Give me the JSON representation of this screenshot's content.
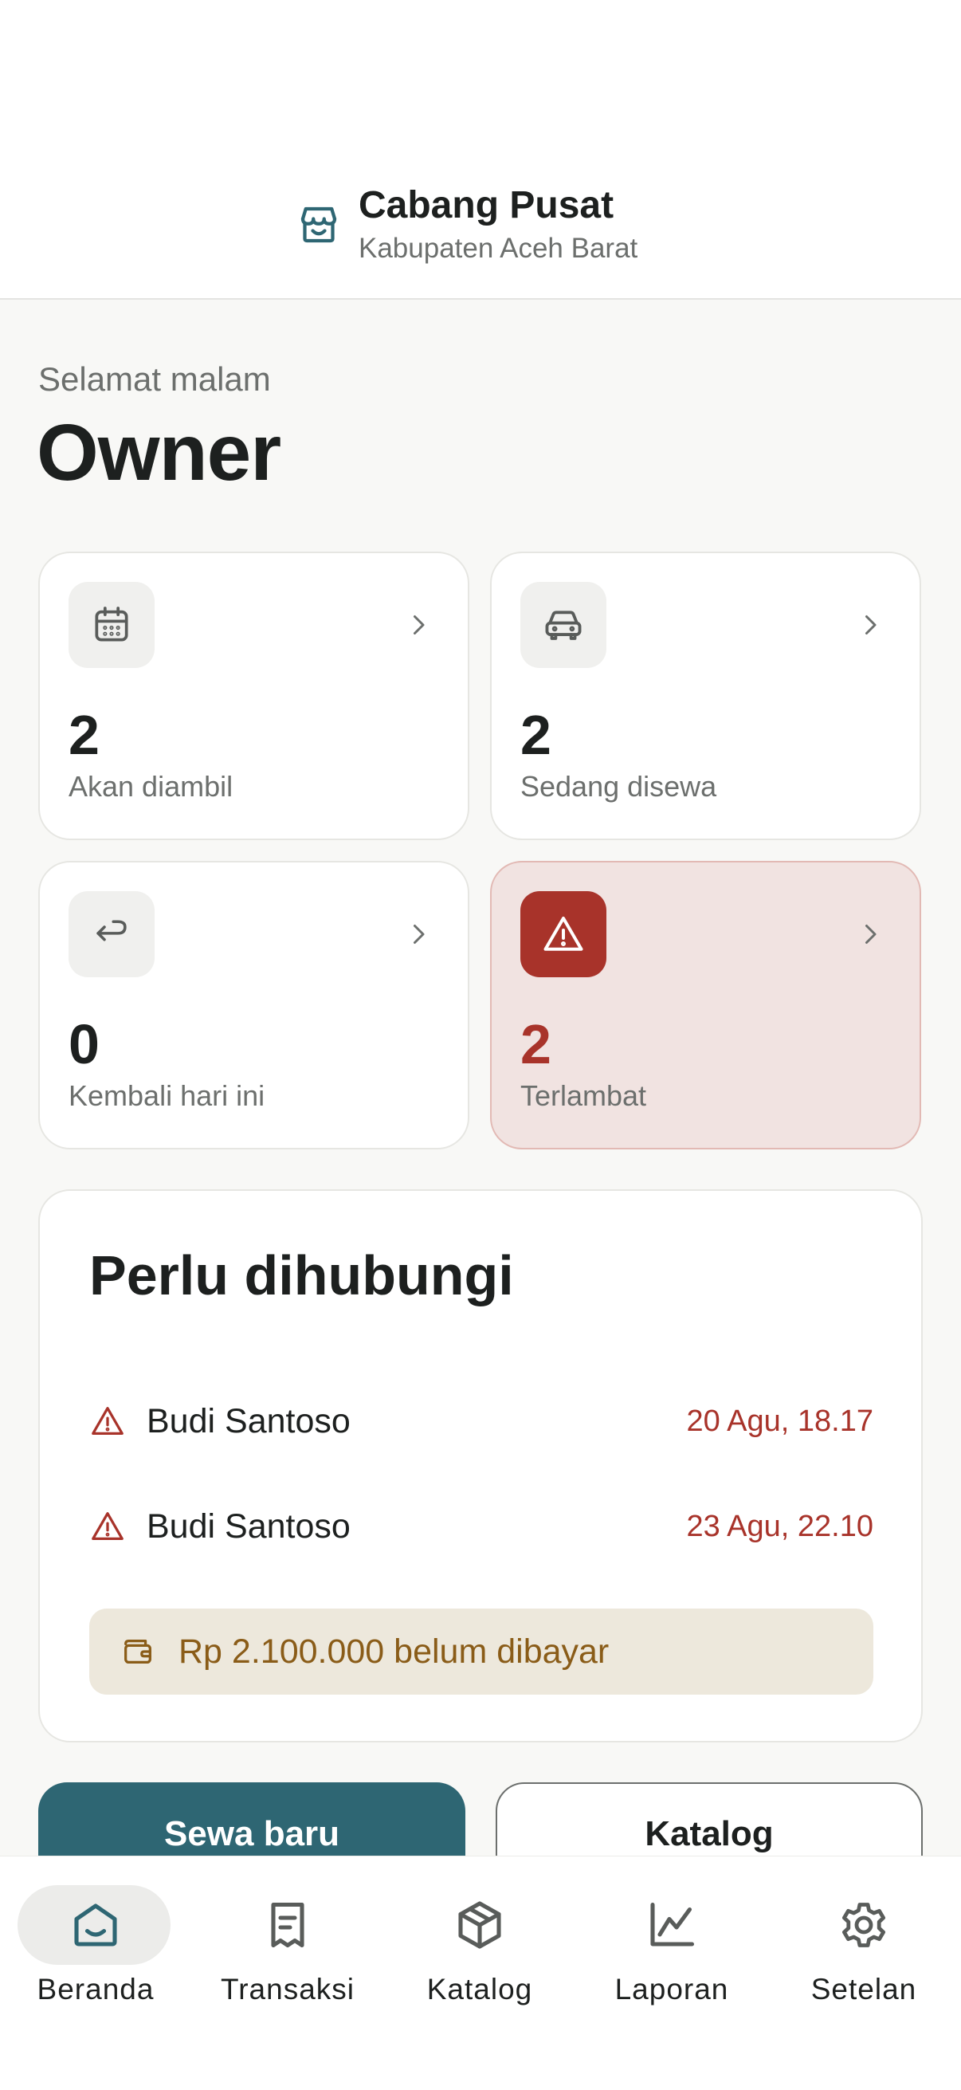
{
  "header": {
    "branch_name": "Cabang Pusat",
    "branch_location": "Kabupaten Aceh Barat",
    "icon": "store-icon"
  },
  "greeting": {
    "salutation": "Selamat malam",
    "user": "Owner"
  },
  "stats": [
    {
      "count": "2",
      "label": "Akan diambil",
      "icon": "calendar-icon"
    },
    {
      "count": "2",
      "label": "Sedang disewa",
      "icon": "car-icon"
    },
    {
      "count": "0",
      "label": "Kembali hari ini",
      "icon": "return-arrow-icon"
    },
    {
      "count": "2",
      "label": "Terlambat",
      "icon": "warning-icon",
      "status": "alert"
    }
  ],
  "contact": {
    "title": "Perlu dihubungi",
    "items": [
      {
        "name": "Budi Santoso",
        "date": "20 Agu, 18.17"
      },
      {
        "name": "Budi Santoso",
        "date": "23 Agu, 22.10"
      }
    ],
    "unpaid": "Rp 2.100.000 belum dibayar"
  },
  "actions": {
    "primary": "Sewa baru",
    "secondary": "Katalog"
  },
  "nav": [
    {
      "label": "Beranda",
      "icon": "home-icon",
      "active": true
    },
    {
      "label": "Transaksi",
      "icon": "receipt-icon"
    },
    {
      "label": "Katalog",
      "icon": "box-icon"
    },
    {
      "label": "Laporan",
      "icon": "chart-icon"
    },
    {
      "label": "Setelan",
      "icon": "gear-icon"
    }
  ],
  "colors": {
    "primary": "#2e6673",
    "danger": "#a8332a",
    "danger_bg": "#f1e3e1",
    "unpaid_bg": "#ede8dc",
    "unpaid_text": "#8a5c18"
  }
}
